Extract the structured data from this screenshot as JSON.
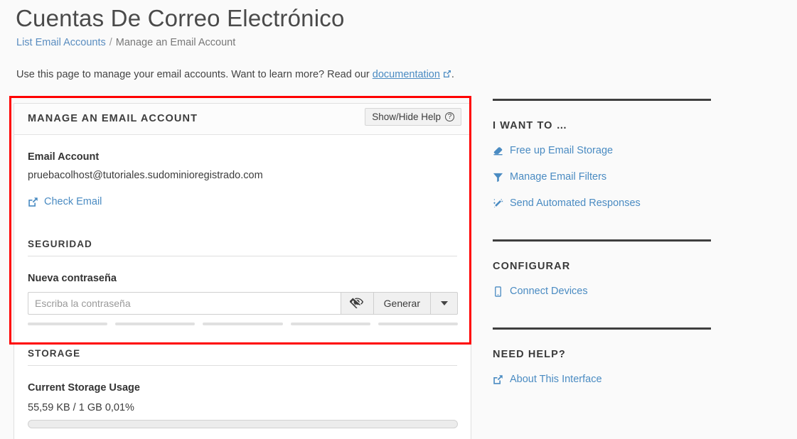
{
  "header": {
    "title": "Cuentas De Correo Electrónico",
    "breadcrumb": {
      "link": "List Email Accounts",
      "separator": "/",
      "current": "Manage an Email Account"
    },
    "intro_before": "Use this page to manage your email accounts. Want to learn more? Read our",
    "intro_link": "documentation",
    "intro_after": ".",
    "intro_link_icon": "external-link-icon"
  },
  "panel": {
    "title": "MANAGE AN EMAIL ACCOUNT",
    "help_button": {
      "label": "Show/Hide Help",
      "icon": "question-circle-icon"
    },
    "email_account": {
      "label": "Email Account",
      "value": "pruebacolhost@tutoriales.sudominioregistrado.com"
    },
    "check_email": {
      "label": "Check Email",
      "icon": "external-link-icon"
    },
    "security": {
      "section_title": "SEGURIDAD",
      "password_label": "Nueva contraseña",
      "password_value": "",
      "password_placeholder": "Escriba la contraseña",
      "toggle_icon": "eye-slash-icon",
      "generate_label": "Generar",
      "dropdown_icon": "chevron-down-icon",
      "strength_segments": 5,
      "strength_filled": 0,
      "strength_color": "#e0e0e0"
    },
    "storage": {
      "section_title": "STORAGE",
      "usage_label": "Current Storage Usage",
      "usage_value": "55,59 KB / 1 GB 0,01%",
      "progress_percent": 0.01
    }
  },
  "sidebar": {
    "groups": [
      {
        "title": "I WANT TO …",
        "links": [
          {
            "label": "Free up Email Storage",
            "icon": "eraser-icon"
          },
          {
            "label": "Manage Email Filters",
            "icon": "filter-icon"
          },
          {
            "label": "Send Automated Responses",
            "icon": "magic-wand-icon"
          }
        ]
      },
      {
        "title": "CONFIGURAR",
        "links": [
          {
            "label": "Connect Devices",
            "icon": "mobile-device-icon"
          }
        ]
      },
      {
        "title": "NEED HELP?",
        "links": [
          {
            "label": "About This Interface",
            "icon": "external-link-icon"
          }
        ]
      }
    ]
  },
  "annotation": {
    "highlight_color": "#ff0000"
  },
  "colors": {
    "link": "#4a8bc2",
    "background": "#fafafa",
    "panel_background": "#ffffff",
    "text": "#333333"
  }
}
